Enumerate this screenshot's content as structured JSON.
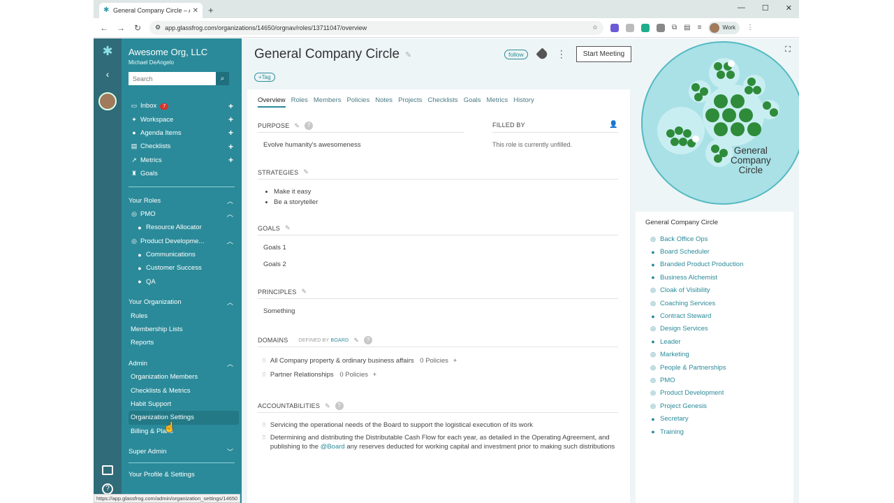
{
  "browser": {
    "tab_title": "General Company Circle – Awe",
    "url": "app.glassfrog.com/organizations/14650/orgnav/roles/13711047/overview",
    "profile": "Work"
  },
  "sidebar": {
    "org_name": "Awesome Org, LLC",
    "user_name": "Michael DeAngelo",
    "search_placeholder": "Search",
    "menu": [
      {
        "label": "Inbox",
        "icon": "inbox-icon",
        "badge": "7"
      },
      {
        "label": "Workspace",
        "icon": "workspace-icon"
      },
      {
        "label": "Agenda Items",
        "icon": "agenda-icon"
      },
      {
        "label": "Checklists",
        "icon": "checklist-icon"
      },
      {
        "label": "Metrics",
        "icon": "metrics-icon"
      },
      {
        "label": "Goals",
        "icon": "trophy-icon"
      }
    ],
    "your_roles": {
      "title": "Your Roles",
      "pmo": "PMO",
      "resource_allocator": "Resource Allocator",
      "product_dev": "Product Developme...",
      "communications": "Communications",
      "customer_success": "Customer Success",
      "qa": "QA"
    },
    "your_org": {
      "title": "Your Organization",
      "items": [
        "Rules",
        "Membership Lists",
        "Reports"
      ]
    },
    "admin": {
      "title": "Admin",
      "items": [
        "Organization Members",
        "Checklists & Metrics",
        "Habit Support",
        "Organization Settings",
        "Billing & Plans"
      ]
    },
    "super_admin": "Super Admin",
    "profile_settings": "Your Profile & Settings"
  },
  "header": {
    "title": "General Company Circle",
    "tag_label": "+Tag",
    "follow_label": "follow",
    "start_meeting": "Start Meeting"
  },
  "tabs": [
    "Overview",
    "Roles",
    "Members",
    "Policies",
    "Notes",
    "Projects",
    "Checklists",
    "Goals",
    "Metrics",
    "History"
  ],
  "sections": {
    "purpose_label": "PURPOSE",
    "purpose_value": "Evolve humanity's awesomeness",
    "filled_by_label": "FILLED BY",
    "filled_by_value": "This role is currently unfilled.",
    "strategies_label": "STRATEGIES",
    "strategies": [
      "Make it easy",
      "Be a storyteller"
    ],
    "goals_label": "GOALS",
    "goals": [
      "Goals 1",
      "Goals 2"
    ],
    "principles_label": "PRINCIPLES",
    "principles_value": "Something",
    "domains_label": "DOMAINS",
    "defined_by": "DEFINED BY",
    "defined_by_link": "BOARD",
    "domains": [
      {
        "name": "All Company property & ordinary business affairs",
        "policies": "0 Policies"
      },
      {
        "name": "Partner Relationships",
        "policies": "0 Policies"
      }
    ],
    "accountabilities_label": "ACCOUNTABILITIES",
    "acc1": "Servicing the operational needs of the Board to support the logistical execution of its work",
    "acc2_a": "Determining and distributing the Distributable Cash Flow for each year, as detailed in the Operating Agreement, and publishing to the",
    "acc2_link": "@Board",
    "acc2_b": "any reserves deducted for working capital and investment prior to making such distributions"
  },
  "circle_viz": {
    "title_line1": "General",
    "title_line2": "Company",
    "title_line3": "Circle"
  },
  "role_list": {
    "title": "General Company Circle",
    "roles": [
      {
        "label": "Back Office Ops",
        "icon": "circle-role-icon"
      },
      {
        "label": "Board Scheduler",
        "icon": "person-icon"
      },
      {
        "label": "Branded Product Production",
        "icon": "person-icon"
      },
      {
        "label": "Business Alchemist",
        "icon": "person-icon"
      },
      {
        "label": "Cloak of Visibility",
        "icon": "circle-role-icon"
      },
      {
        "label": "Coaching Services",
        "icon": "circle-role-icon"
      },
      {
        "label": "Contract Steward",
        "icon": "person-icon"
      },
      {
        "label": "Design Services",
        "icon": "circle-role-icon"
      },
      {
        "label": "Leader",
        "icon": "person-icon"
      },
      {
        "label": "Marketing",
        "icon": "circle-role-icon"
      },
      {
        "label": "People & Partnerships",
        "icon": "circle-role-icon"
      },
      {
        "label": "PMO",
        "icon": "circle-role-icon"
      },
      {
        "label": "Product Development",
        "icon": "circle-role-icon"
      },
      {
        "label": "Project Genesis",
        "icon": "circle-role-icon"
      },
      {
        "label": "Secretary",
        "icon": "person-icon"
      },
      {
        "label": "Training",
        "icon": "person-icon"
      }
    ]
  },
  "status_url": "https://app.glassfrog.com/admin/organization_settings/14650",
  "colors": {
    "teal": "#2a8a99",
    "dark_teal": "#2f6b78",
    "badge": "#d9332b"
  }
}
